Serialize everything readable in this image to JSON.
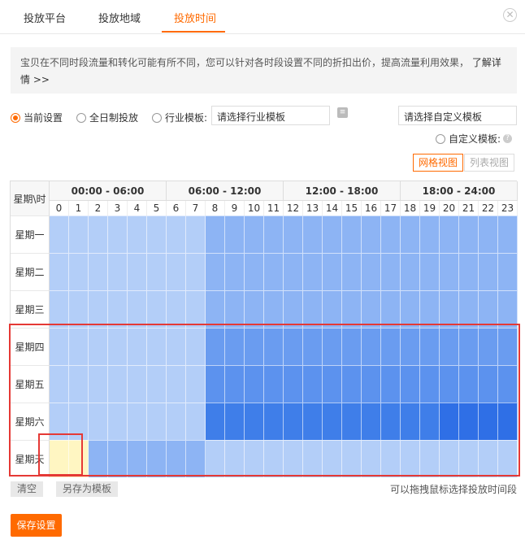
{
  "tabs": [
    {
      "label": "投放平台",
      "active": false
    },
    {
      "label": "投放地域",
      "active": false
    },
    {
      "label": "投放时间",
      "active": true
    }
  ],
  "close_icon": "close-icon",
  "notice": {
    "text": "宝贝在不同时段流量和转化可能有所不同，您可以针对各时段设置不同的折扣出价，提高流量利用效果，",
    "more": "了解详情 >>"
  },
  "options": {
    "current": "当前设置",
    "allday": "全日制投放",
    "industry": "行业模板:",
    "industry_placeholder": "请选择行业模板",
    "custom_placeholder": "请选择自定义模板",
    "custom": "自定义模板:",
    "selected": "current"
  },
  "views": {
    "grid": "网格视图",
    "list": "列表视图",
    "active": "grid"
  },
  "grid": {
    "corner": "星期\\时",
    "groups": [
      "00:00 - 06:00",
      "06:00 - 12:00",
      "12:00 - 18:00",
      "18:00 - 24:00"
    ],
    "hours": [
      "0",
      "1",
      "2",
      "3",
      "4",
      "5",
      "6",
      "7",
      "8",
      "9",
      "10",
      "11",
      "12",
      "13",
      "14",
      "15",
      "16",
      "17",
      "18",
      "19",
      "20",
      "21",
      "22",
      "23"
    ],
    "days": [
      "星期一",
      "星期二",
      "星期三",
      "星期四",
      "星期五",
      "星期六",
      "星期天"
    ],
    "levels": [
      [
        0,
        0,
        0,
        0,
        0,
        0,
        0,
        0,
        1,
        1,
        1,
        1,
        1,
        1,
        1,
        1,
        1,
        1,
        1,
        1,
        1,
        1,
        1,
        1
      ],
      [
        0,
        0,
        0,
        0,
        0,
        0,
        0,
        0,
        1,
        1,
        1,
        1,
        1,
        1,
        1,
        1,
        1,
        1,
        1,
        1,
        1,
        1,
        1,
        1
      ],
      [
        0,
        0,
        0,
        0,
        0,
        0,
        0,
        0,
        1,
        1,
        1,
        1,
        1,
        1,
        1,
        1,
        1,
        1,
        1,
        1,
        1,
        1,
        1,
        1
      ],
      [
        0,
        0,
        0,
        0,
        0,
        0,
        0,
        0,
        2,
        2,
        2,
        2,
        2,
        2,
        2,
        2,
        2,
        2,
        2,
        2,
        2,
        2,
        2,
        2
      ],
      [
        0,
        0,
        0,
        0,
        0,
        0,
        0,
        0,
        3,
        3,
        3,
        3,
        3,
        3,
        3,
        3,
        3,
        3,
        3,
        3,
        3,
        3,
        3,
        3
      ],
      [
        0,
        0,
        0,
        0,
        0,
        0,
        0,
        0,
        4,
        4,
        4,
        4,
        4,
        4,
        4,
        4,
        4,
        4,
        4,
        4,
        5,
        5,
        5,
        5
      ],
      [
        6,
        6,
        1,
        1,
        1,
        1,
        1,
        1,
        0,
        0,
        0,
        0,
        0,
        0,
        0,
        0,
        0,
        0,
        0,
        0,
        0,
        0,
        0,
        0
      ]
    ],
    "colors": [
      "#b3cef8",
      "#8db4f4",
      "#6a9cf0",
      "#5c92ee",
      "#3f7ee9",
      "#2f6fe6",
      "#fff6c2"
    ]
  },
  "footer": {
    "clear": "清空",
    "save_template": "另存为模板",
    "hint": "可以拖拽鼠标选择投放时间段",
    "save": "保存设置"
  }
}
